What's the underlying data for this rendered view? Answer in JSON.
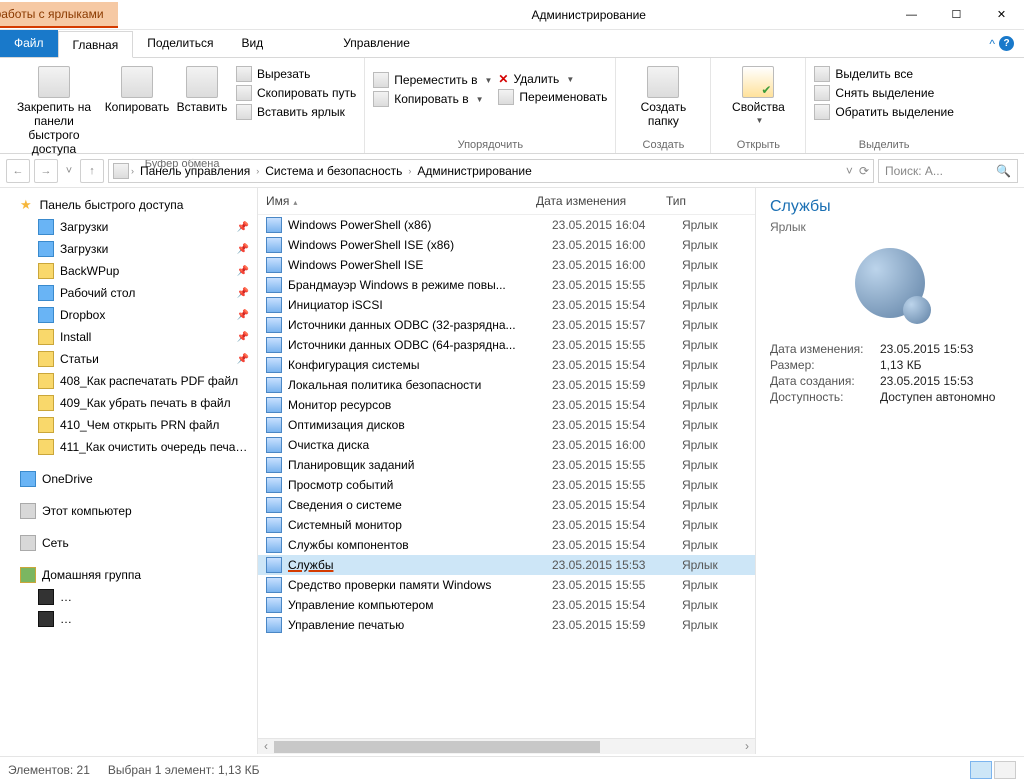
{
  "qat": {
    "dropdown_glyph": "▾"
  },
  "contextual_tab": "Средства работы с ярлыками",
  "window_title": "Администрирование",
  "win_controls": {
    "min": "—",
    "max": "☐",
    "close": "✕"
  },
  "tabs": {
    "file": "Файл",
    "home": "Главная",
    "share": "Поделиться",
    "view": "Вид",
    "manage": "Управление",
    "expand": "^"
  },
  "ribbon": {
    "clipboard": {
      "pin": "Закрепить на панели быстрого доступа",
      "copy": "Копировать",
      "paste": "Вставить",
      "cut": "Вырезать",
      "copy_path": "Скопировать путь",
      "paste_shortcut": "Вставить ярлык",
      "label": "Буфер обмена"
    },
    "organize": {
      "move_to": "Переместить в",
      "copy_to": "Копировать в",
      "delete": "Удалить",
      "rename": "Переименовать",
      "label": "Упорядочить"
    },
    "new": {
      "new_folder": "Создать папку",
      "label": "Создать"
    },
    "open": {
      "properties": "Свойства",
      "label": "Открыть"
    },
    "select": {
      "select_all": "Выделить все",
      "select_none": "Снять выделение",
      "invert": "Обратить выделение",
      "label": "Выделить"
    }
  },
  "addr": {
    "back": "←",
    "forward": "→",
    "recent": "˅",
    "up": "↑",
    "crumbs": [
      "Панель управления",
      "Система и безопасность",
      "Администрирование"
    ],
    "refresh": "⟳",
    "search_placeholder": "Поиск: А..."
  },
  "nav": {
    "quick_access": "Панель быстрого доступа",
    "items": [
      {
        "label": "Загрузки",
        "icon": "blue",
        "pin": true
      },
      {
        "label": "Загрузки",
        "icon": "blue",
        "pin": true
      },
      {
        "label": "BackWPup",
        "icon": "folder",
        "pin": true
      },
      {
        "label": "Рабочий стол",
        "icon": "blue",
        "pin": true
      },
      {
        "label": "Dropbox",
        "icon": "blue",
        "pin": true
      },
      {
        "label": "Install",
        "icon": "folder",
        "pin": true
      },
      {
        "label": "Статьи",
        "icon": "folder",
        "pin": true
      },
      {
        "label": "408_Как распечатать PDF файл",
        "icon": "folder",
        "pin": false
      },
      {
        "label": "409_Как убрать печать в файл",
        "icon": "folder",
        "pin": false
      },
      {
        "label": "410_Чем открыть PRN файл",
        "icon": "folder",
        "pin": false
      },
      {
        "label": "411_Как очистить очередь печа…",
        "icon": "folder",
        "pin": false
      }
    ],
    "onedrive": "OneDrive",
    "this_pc": "Этот компьютер",
    "network": "Сеть",
    "homegroup": "Домашняя группа"
  },
  "columns": {
    "name": "Имя",
    "date": "Дата изменения",
    "type": "Тип"
  },
  "files": [
    {
      "name": "Windows PowerShell (x86)",
      "date": "23.05.2015 16:04",
      "type": "Ярлык"
    },
    {
      "name": "Windows PowerShell ISE (x86)",
      "date": "23.05.2015 16:00",
      "type": "Ярлык"
    },
    {
      "name": "Windows PowerShell ISE",
      "date": "23.05.2015 16:00",
      "type": "Ярлык"
    },
    {
      "name": "Брандмауэр Windows в режиме повы...",
      "date": "23.05.2015 15:55",
      "type": "Ярлык"
    },
    {
      "name": "Инициатор iSCSI",
      "date": "23.05.2015 15:54",
      "type": "Ярлык"
    },
    {
      "name": "Источники данных ODBC (32-разрядна...",
      "date": "23.05.2015 15:57",
      "type": "Ярлык"
    },
    {
      "name": "Источники данных ODBC (64-разрядна...",
      "date": "23.05.2015 15:55",
      "type": "Ярлык"
    },
    {
      "name": "Конфигурация системы",
      "date": "23.05.2015 15:54",
      "type": "Ярлык"
    },
    {
      "name": "Локальная политика безопасности",
      "date": "23.05.2015 15:59",
      "type": "Ярлык"
    },
    {
      "name": "Монитор ресурсов",
      "date": "23.05.2015 15:54",
      "type": "Ярлык"
    },
    {
      "name": "Оптимизация дисков",
      "date": "23.05.2015 15:54",
      "type": "Ярлык"
    },
    {
      "name": "Очистка диска",
      "date": "23.05.2015 16:00",
      "type": "Ярлык"
    },
    {
      "name": "Планировщик заданий",
      "date": "23.05.2015 15:55",
      "type": "Ярлык"
    },
    {
      "name": "Просмотр событий",
      "date": "23.05.2015 15:55",
      "type": "Ярлык"
    },
    {
      "name": "Сведения о системе",
      "date": "23.05.2015 15:54",
      "type": "Ярлык"
    },
    {
      "name": "Системный монитор",
      "date": "23.05.2015 15:54",
      "type": "Ярлык"
    },
    {
      "name": "Службы компонентов",
      "date": "23.05.2015 15:54",
      "type": "Ярлык"
    },
    {
      "name": "Службы",
      "date": "23.05.2015 15:53",
      "type": "Ярлык",
      "selected": true,
      "underline": true
    },
    {
      "name": "Средство проверки памяти Windows",
      "date": "23.05.2015 15:55",
      "type": "Ярлык"
    },
    {
      "name": "Управление компьютером",
      "date": "23.05.2015 15:54",
      "type": "Ярлык"
    },
    {
      "name": "Управление печатью",
      "date": "23.05.2015 15:59",
      "type": "Ярлык"
    }
  ],
  "details": {
    "title": "Службы",
    "subtype": "Ярлык",
    "props": [
      {
        "label": "Дата изменения:",
        "value": "23.05.2015 15:53"
      },
      {
        "label": "Размер:",
        "value": "1,13 КБ"
      },
      {
        "label": "Дата создания:",
        "value": "23.05.2015 15:53"
      },
      {
        "label": "Доступность:",
        "value": "Доступен автономно"
      }
    ]
  },
  "status": {
    "count": "Элементов: 21",
    "selection": "Выбран 1 элемент: 1,13 КБ"
  }
}
